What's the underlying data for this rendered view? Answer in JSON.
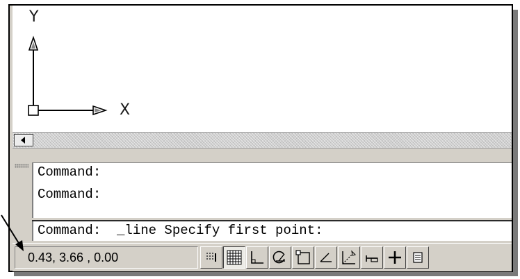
{
  "drawing": {
    "ucs_icon": "ucs-icon",
    "axis_y_label": "Y",
    "axis_x_label": "X"
  },
  "scrollbar": {
    "left_arrow_icon": "scroll-left-arrow-icon"
  },
  "command": {
    "history": [
      "Command:",
      "Command:"
    ],
    "current": "Command:  _line Specify first point:"
  },
  "status": {
    "coordinates": "0.43, 3.66 , 0.00",
    "buttons": [
      {
        "name": "infer-constraints-button",
        "icon": "infer-icon",
        "on": false
      },
      {
        "name": "grid-button",
        "icon": "grid-icon",
        "on": true
      },
      {
        "name": "ortho-button",
        "icon": "ortho-icon",
        "on": false
      },
      {
        "name": "polar-tracking-button",
        "icon": "polar-icon",
        "on": false
      },
      {
        "name": "object-snap-button",
        "icon": "osnap-icon",
        "on": false
      },
      {
        "name": "object-snap-tracking-button",
        "icon": "otrack-icon",
        "on": false
      },
      {
        "name": "dynamic-ucs-button",
        "icon": "ducs-icon",
        "on": false
      },
      {
        "name": "dynamic-input-button",
        "icon": "dyn-icon",
        "on": false
      },
      {
        "name": "lineweight-button",
        "icon": "lineweight-icon",
        "on": false
      },
      {
        "name": "quick-properties-button",
        "icon": "qp-icon",
        "on": false
      }
    ]
  },
  "colors": {
    "chrome": "#d4d0c8",
    "canvas": "#ffffff",
    "border": "#000000"
  }
}
